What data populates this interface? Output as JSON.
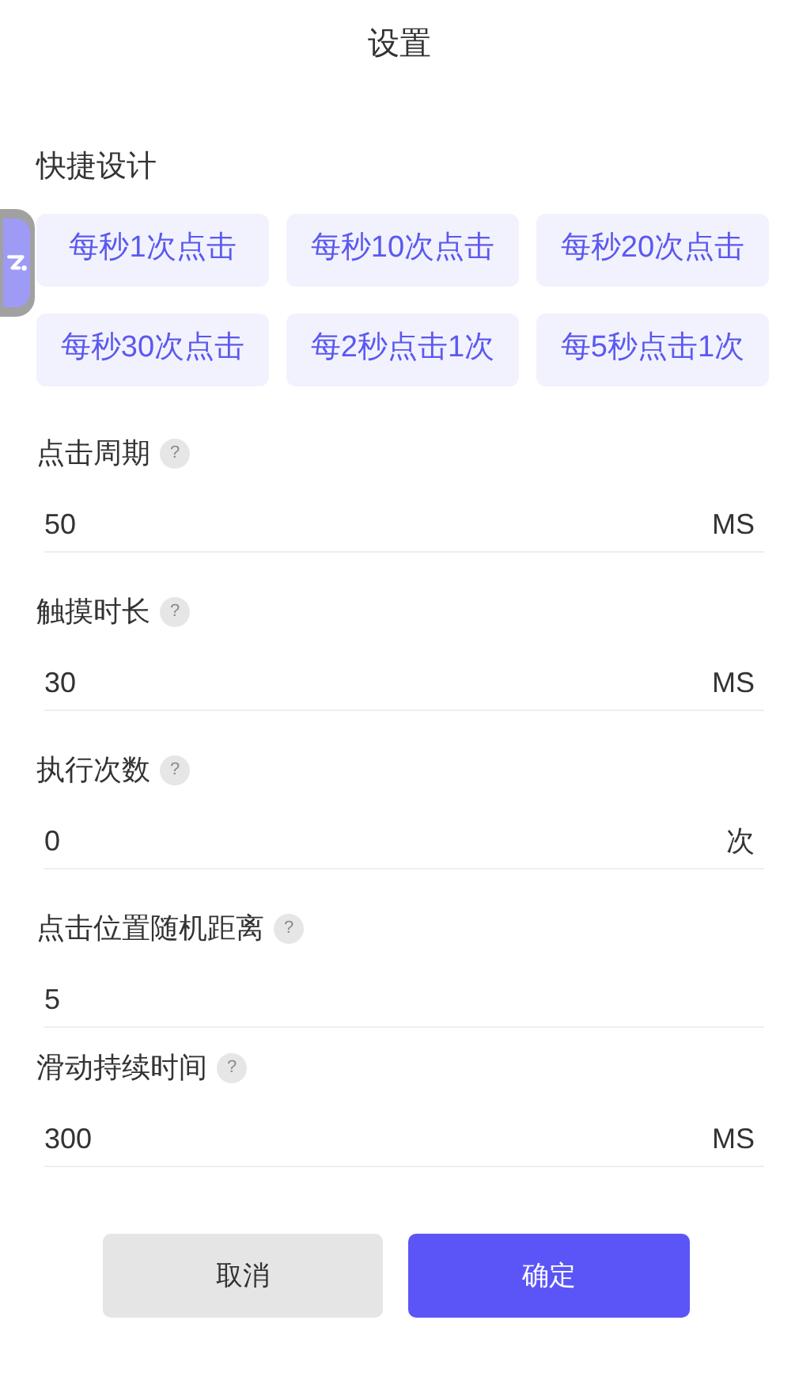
{
  "title": "设置",
  "quick_section": {
    "label": "快捷设计",
    "presets": [
      "每秒1次点击",
      "每秒10次点击",
      "每秒20次点击",
      "每秒30次点击",
      "每2秒点击1次",
      "每5秒点击1次"
    ]
  },
  "fields": [
    {
      "label": "点击周期",
      "help": "?",
      "value": "50",
      "unit": "MS"
    },
    {
      "label": "触摸时长",
      "help": "?",
      "value": "30",
      "unit": "MS"
    },
    {
      "label": "执行次数",
      "help": "?",
      "value": "0",
      "unit": "次"
    },
    {
      "label": "点击位置随机距离",
      "help": "?",
      "value": "5"
    },
    {
      "label": "滑动持续时间",
      "help": "?",
      "value": "300",
      "unit": "MS"
    }
  ],
  "buttons": {
    "cancel": "取消",
    "confirm": "确定"
  }
}
